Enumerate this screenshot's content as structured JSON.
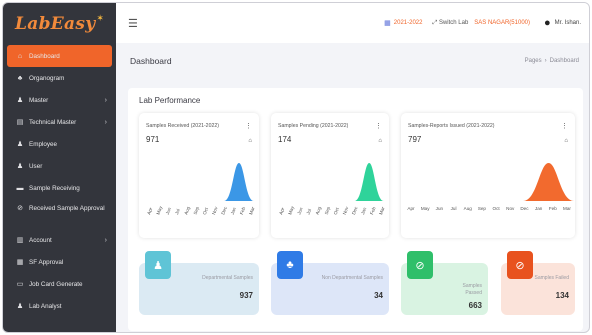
{
  "app": {
    "logo": "LabEasy"
  },
  "sidebar": {
    "items": [
      {
        "label": "Dashboard",
        "icon": "home-icon",
        "active": true
      },
      {
        "label": "Organogram",
        "icon": "sitemap-icon"
      },
      {
        "label": "Master",
        "icon": "users-icon",
        "chevron": true
      },
      {
        "label": "Technical Master",
        "icon": "grid-icon",
        "chevron": true
      },
      {
        "label": "Employee",
        "icon": "user-icon"
      },
      {
        "label": "User",
        "icon": "user-icon"
      },
      {
        "label": "Sample Receiving",
        "icon": "pill-icon"
      },
      {
        "label": "Received Sample Approval",
        "icon": "check-circle-icon"
      },
      {
        "label": "Account",
        "icon": "ledger-icon",
        "chevron": true
      },
      {
        "label": "SF Approval",
        "icon": "stamp-icon"
      },
      {
        "label": "Job Card Generate",
        "icon": "card-icon"
      },
      {
        "label": "Lab Analyst",
        "icon": "user-icon"
      }
    ]
  },
  "topbar": {
    "year": "2021-2022",
    "switch_lab": "Switch Lab",
    "lab_name": "SAS NAGAR(51000)",
    "user": "Mr. Ishan."
  },
  "page": {
    "title": "Dashboard",
    "breadcrumb": [
      "Pages",
      "Dashboard"
    ]
  },
  "panel": {
    "title": "Lab Performance"
  },
  "cards": [
    {
      "title": "Samples Received (2021-2022)",
      "value": "971",
      "color": "#3b97e6"
    },
    {
      "title": "Samples Pending (2021-2022)",
      "value": "174",
      "color": "#2fd39a"
    },
    {
      "title": "Samples-Reports Issued (2021-2022)",
      "value": "797",
      "color": "#f26a2e"
    }
  ],
  "chart_data": [
    {
      "type": "area",
      "title": "Samples Received (2021-2022)",
      "categories": [
        "Apr",
        "May",
        "Jun",
        "Jul",
        "Aug",
        "Sep",
        "Oct",
        "Nov",
        "Dec",
        "Jan",
        "Feb",
        "Mar"
      ]
    },
    {
      "type": "area",
      "title": "Samples Pending (2021-2022)",
      "categories": [
        "Apr",
        "May",
        "Jun",
        "Jul",
        "Aug",
        "Sep",
        "Oct",
        "Nov",
        "Dec",
        "Jan",
        "Feb",
        "Mar"
      ]
    },
    {
      "type": "area",
      "title": "Samples-Reports Issued (2021-2022)",
      "categories": [
        "Apr",
        "May",
        "Jun",
        "Jul",
        "Aug",
        "Sep",
        "Oct",
        "Nov",
        "Dec",
        "Jan",
        "Feb",
        "Mar"
      ]
    }
  ],
  "stats": [
    {
      "label": "Departmental Samples",
      "value": "937",
      "bg": "#dbeaf3",
      "icon_bg": "#5fc4d6",
      "icon": "person-icon"
    },
    {
      "label": "Non Departmental Samples",
      "value": "34",
      "bg": "#dde6f8",
      "icon_bg": "#2f7be6",
      "icon": "group-icon"
    },
    {
      "label": "Samples Passed",
      "value": "663",
      "bg": "#d9f3e2",
      "icon_bg": "#2fbf6a",
      "icon": "check-shield-icon"
    },
    {
      "label": "Samples Failed",
      "value": "134",
      "bg": "#fbe3da",
      "icon_bg": "#e8521e",
      "icon": "ban-icon"
    }
  ]
}
